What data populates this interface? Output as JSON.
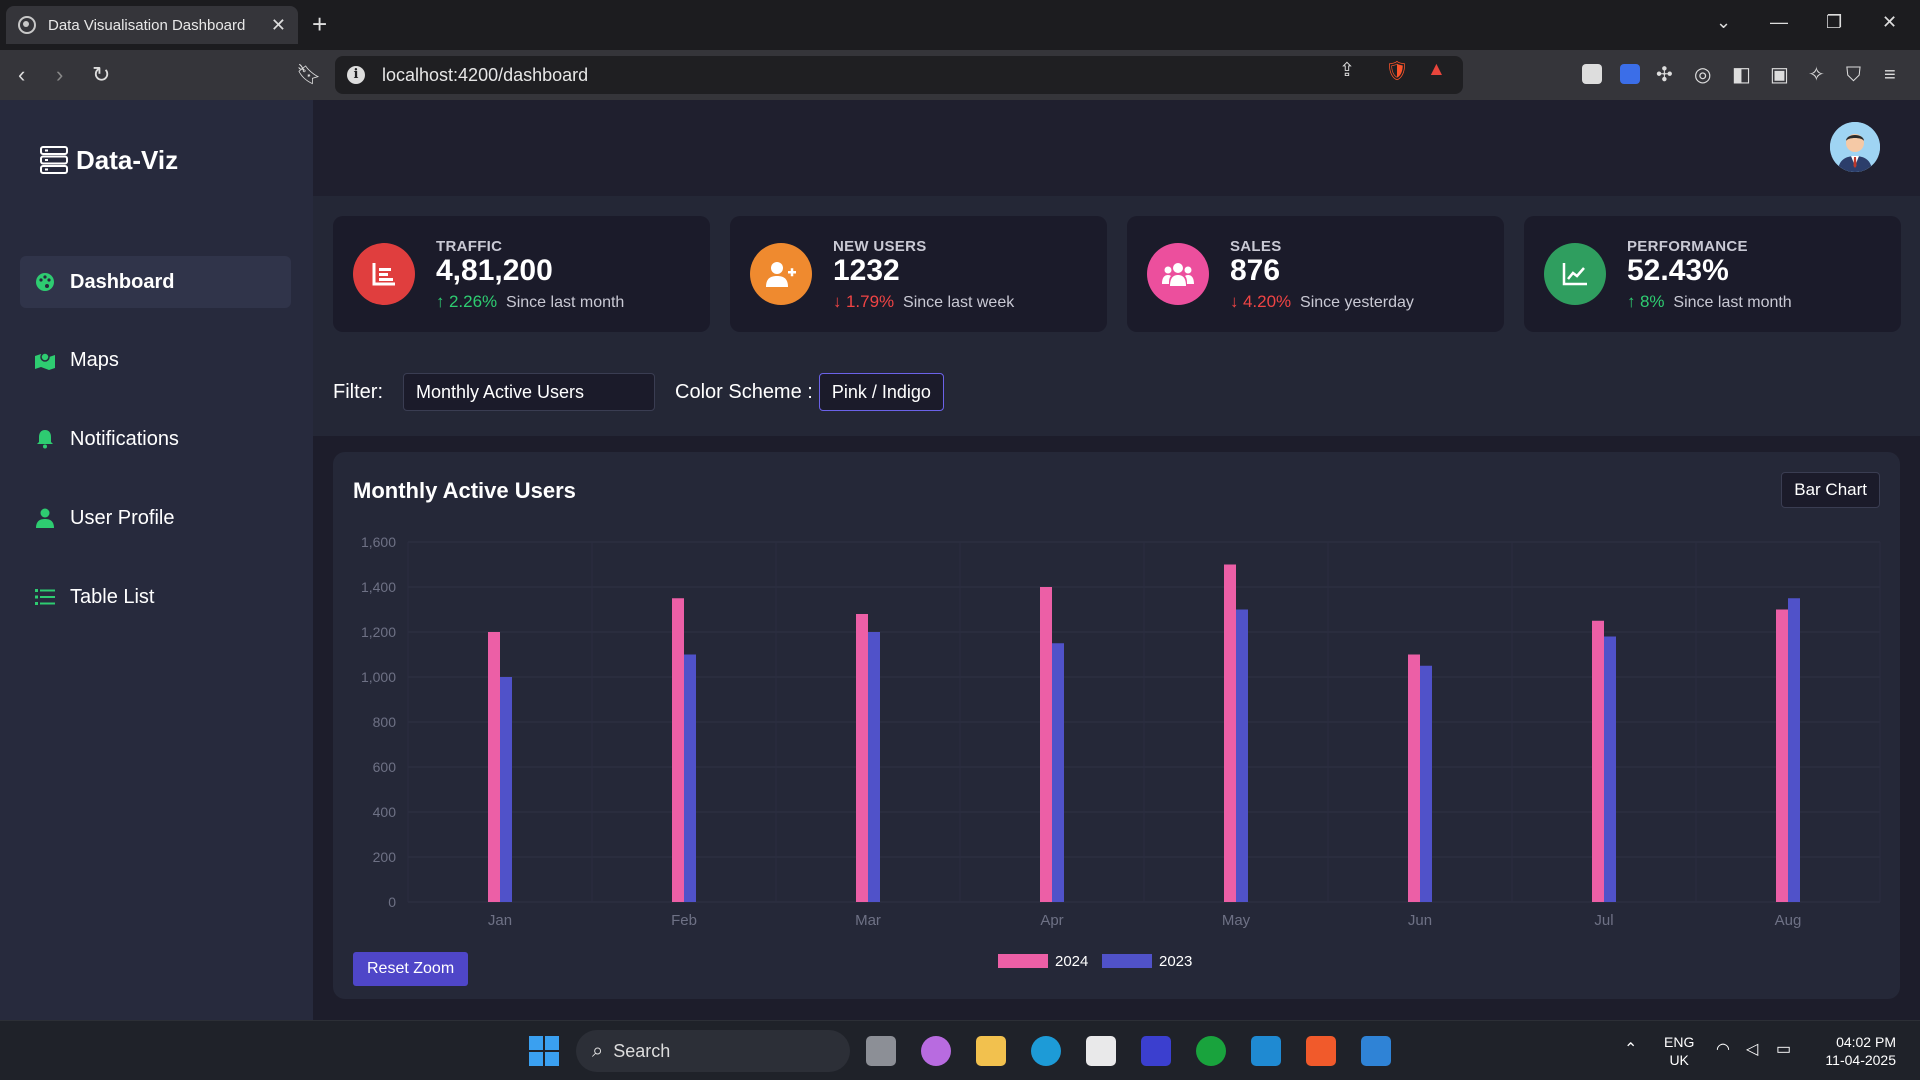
{
  "browser": {
    "tab_title": "Data Visualisation Dashboard",
    "url": "localhost:4200/dashboard"
  },
  "sidebar": {
    "brand": "Data-Viz",
    "items": [
      {
        "label": "Dashboard",
        "icon": "palette-icon",
        "active": true
      },
      {
        "label": "Maps",
        "icon": "map-icon",
        "active": false
      },
      {
        "label": "Notifications",
        "icon": "bell-icon",
        "active": false
      },
      {
        "label": "User Profile",
        "icon": "user-icon",
        "active": false
      },
      {
        "label": "Table List",
        "icon": "list-icon",
        "active": false
      }
    ]
  },
  "stats": [
    {
      "label": "TRAFFIC",
      "value": "4,81,200",
      "arrow": "↑",
      "change": "2.26%",
      "period": "Since last month",
      "trend": "up",
      "color": "#e03e3e",
      "icon": "bar-chart-icon"
    },
    {
      "label": "NEW USERS",
      "value": "1232",
      "arrow": "↓",
      "change": "1.79%",
      "period": "Since last week",
      "trend": "down",
      "color": "#ef8a2f",
      "icon": "user-plus-icon"
    },
    {
      "label": "SALES",
      "value": "876",
      "arrow": "↓",
      "change": "4.20%",
      "period": "Since yesterday",
      "trend": "down",
      "color": "#ec4f9d",
      "icon": "users-icon"
    },
    {
      "label": "PERFORMANCE",
      "value": "52.43%",
      "arrow": "↑",
      "change": "8%",
      "period": "Since last month",
      "trend": "up",
      "color": "#2f9e5f",
      "icon": "line-chart-icon"
    }
  ],
  "filters": {
    "filter_label": "Filter:",
    "filter_value": "Monthly Active Users",
    "scheme_label": "Color Scheme :",
    "scheme_value": "Pink / Indigo"
  },
  "chart_panel": {
    "title": "Monthly Active Users",
    "chart_type": "Bar Chart",
    "reset_label": "Reset Zoom"
  },
  "chart_data": {
    "type": "bar",
    "categories": [
      "Jan",
      "Feb",
      "Mar",
      "Apr",
      "May",
      "Jun",
      "Jul",
      "Aug"
    ],
    "series": [
      {
        "name": "2024",
        "color": "#ec5fa6",
        "values": [
          1200,
          1350,
          1280,
          1400,
          1500,
          1100,
          1250,
          1300
        ]
      },
      {
        "name": "2023",
        "color": "#5052c9",
        "values": [
          1000,
          1100,
          1200,
          1150,
          1300,
          1050,
          1180,
          1350
        ]
      }
    ],
    "ylim": [
      0,
      1600
    ],
    "yticks": [
      "0",
      "200",
      "400",
      "600",
      "800",
      "1,000",
      "1,200",
      "1,400",
      "1,600"
    ],
    "legend_position": "bottom"
  },
  "taskbar": {
    "search_label": "Search",
    "lang_1": "ENG",
    "lang_2": "UK",
    "time": "04:02 PM",
    "date": "11-04-2025"
  }
}
